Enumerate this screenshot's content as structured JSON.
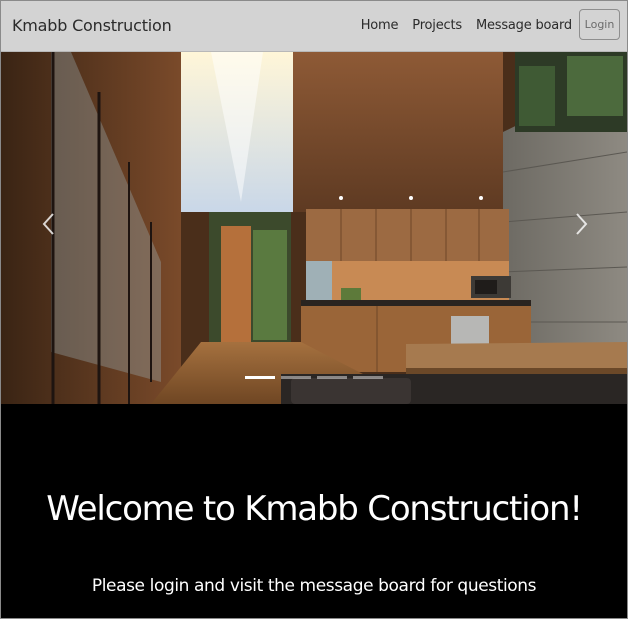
{
  "navbar": {
    "brand": "Kmabb Construction",
    "links": [
      "Home",
      "Projects",
      "Message board"
    ],
    "login_label": "Login"
  },
  "carousel": {
    "prev_icon": "chevron-left-icon",
    "next_icon": "chevron-right-icon",
    "slide_count": 4,
    "active_slide": 1
  },
  "hero": {
    "title": "Welcome to Kmabb Construction!",
    "subtitle": "Please login and visit the message board for questions"
  }
}
